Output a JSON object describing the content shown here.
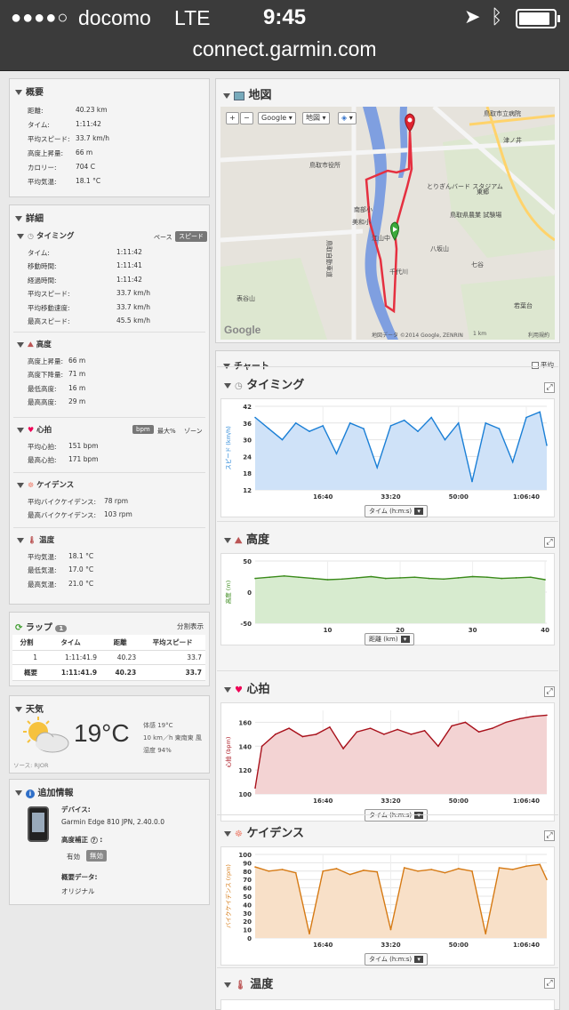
{
  "statusbar": {
    "signal": "●●●●○",
    "carrier": "docomo",
    "network": "LTE",
    "time": "9:45"
  },
  "browser": {
    "url": "connect.garmin.com"
  },
  "summary": {
    "title": "概要",
    "rows": [
      {
        "label": "距離:",
        "value": "40.23 km"
      },
      {
        "label": "タイム:",
        "value": "1:11:42"
      },
      {
        "label": "平均スピード:",
        "value": "33.7 km/h"
      },
      {
        "label": "高度上昇量:",
        "value": "66 m"
      },
      {
        "label": "カロリー:",
        "value": "704 C"
      },
      {
        "label": "平均気温:",
        "value": "18.1 °C"
      }
    ]
  },
  "details": {
    "title": "詳細",
    "timing": {
      "title": "タイミング",
      "toggle_pace": "ペース",
      "toggle_speed": "スピード",
      "rows": [
        {
          "label": "タイム:",
          "value": "1:11:42"
        },
        {
          "label": "移動時間:",
          "value": "1:11:41"
        },
        {
          "label": "経過時間:",
          "value": "1:11:42"
        },
        {
          "label": "平均スピード:",
          "value": "33.7 km/h"
        },
        {
          "label": "平均移動速度:",
          "value": "33.7 km/h"
        },
        {
          "label": "最高スピード:",
          "value": "45.5 km/h"
        }
      ]
    },
    "elevation": {
      "title": "高度",
      "rows": [
        {
          "label": "高度上昇量:",
          "value": "66 m"
        },
        {
          "label": "高度下降量:",
          "value": "71 m"
        },
        {
          "label": "最低高度:",
          "value": "16 m"
        },
        {
          "label": "最高高度:",
          "value": "29 m"
        }
      ]
    },
    "heartrate": {
      "title": "心拍",
      "chip_bpm": "bpm",
      "chip_max": "最大%",
      "chip_zone": "ゾーン",
      "rows": [
        {
          "label": "平均心拍:",
          "value": "151 bpm"
        },
        {
          "label": "最高心拍:",
          "value": "171 bpm"
        }
      ]
    },
    "cadence": {
      "title": "ケイデンス",
      "rows": [
        {
          "label": "平均バイクケイデンス:",
          "value": "78 rpm"
        },
        {
          "label": "最高バイクケイデンス:",
          "value": "103 rpm"
        }
      ]
    },
    "temperature": {
      "title": "温度",
      "rows": [
        {
          "label": "平均気温:",
          "value": "18.1 °C"
        },
        {
          "label": "最低気温:",
          "value": "17.0 °C"
        },
        {
          "label": "最高気温:",
          "value": "21.0 °C"
        }
      ]
    }
  },
  "laps": {
    "title": "ラップ",
    "count": "1",
    "action": "分割表示",
    "headers": [
      "分割",
      "タイム",
      "距離",
      "平均スピード"
    ],
    "rows": [
      [
        "1",
        "1:11:41.9",
        "40.23",
        "33.7"
      ],
      [
        "概要",
        "1:11:41.9",
        "40.23",
        "33.7"
      ]
    ]
  },
  "weather": {
    "title": "天気",
    "temp": "19°C",
    "line1": "体感 19°C",
    "line2": "10 km／h 東南東 風",
    "line3": "湿度 94%",
    "source": "ソース: RJOR"
  },
  "info": {
    "title": "追加情報",
    "device_label": "デバイス:",
    "device": "Garmin Edge 810 JPN, 2.40.0.0",
    "elev_label": "高度補正",
    "elev_on": "有効",
    "elev_off": "無効",
    "data_label": "概要データ:",
    "data_value": "オリジナル"
  },
  "map": {
    "title": "地図",
    "zoom_in": "+",
    "zoom_out": "−",
    "btn_google": "Google",
    "btn_map": "地図",
    "attribution": "地図データ ©2014 Google, ZENRIN",
    "scale": "1 km",
    "terms": "利用規約",
    "logo": "Google",
    "places": [
      "鳥取市役所",
      "鳥取市立病院",
      "とりぎんバード スタジアム",
      "東郷",
      "鳥取県農業 試験場",
      "八坂山",
      "江山中",
      "美和小",
      "千代川",
      "七谷",
      "表谷山",
      "津ノ井",
      "鳥取自動車道",
      "若葉台",
      "南部小"
    ]
  },
  "charts": {
    "title": "チャート",
    "avg_label": "平均",
    "speed": {
      "title": "タイミング",
      "selector": "タイム (h:m:s)"
    },
    "elevation": {
      "title": "高度",
      "selector": "距離 (km)"
    },
    "hr": {
      "title": "心拍",
      "selector": "タイム (h:m:s)"
    },
    "cadence": {
      "title": "ケイデンス",
      "selector": "タイム (h:m:s)"
    },
    "temp": {
      "title": "温度"
    }
  },
  "chart_data": [
    {
      "type": "area",
      "title": "タイミング",
      "ylabel": "スピード (km/h)",
      "xlabel": "",
      "ylim": [
        12,
        42
      ],
      "yticks": [
        12,
        18,
        24,
        30,
        36,
        42
      ],
      "xticks": [
        "16:40",
        "33:20",
        "50:00",
        "1:06:40"
      ],
      "xrange_seconds": [
        0,
        4302
      ],
      "x": [
        0,
        200,
        400,
        600,
        800,
        1000,
        1200,
        1400,
        1600,
        1800,
        2000,
        2200,
        2400,
        2600,
        2800,
        3000,
        3200,
        3400,
        3600,
        3800,
        4000,
        4200,
        4302
      ],
      "y": [
        38,
        34,
        30,
        36,
        33,
        35,
        25,
        36,
        34,
        20,
        35,
        37,
        33,
        38,
        30,
        36,
        15,
        36,
        34,
        22,
        38,
        40,
        28
      ],
      "color": "#1a7fd6"
    },
    {
      "type": "area",
      "title": "高度",
      "ylabel": "高度 (m)",
      "xlabel": "",
      "ylim": [
        -50,
        50
      ],
      "yticks": [
        -50,
        0,
        50
      ],
      "xticks": [
        10,
        20,
        30,
        40
      ],
      "xrange": [
        0,
        40.23
      ],
      "x": [
        0,
        2,
        4,
        6,
        8,
        10,
        12,
        14,
        16,
        18,
        20,
        22,
        24,
        26,
        28,
        30,
        32,
        34,
        36,
        38,
        40
      ],
      "y": [
        22,
        24,
        26,
        24,
        22,
        20,
        21,
        23,
        25,
        22,
        23,
        24,
        22,
        21,
        23,
        25,
        24,
        22,
        23,
        24,
        20
      ],
      "color": "#3a8a1a"
    },
    {
      "type": "area",
      "title": "心拍",
      "ylabel": "心拍 (bpm)",
      "xlabel": "",
      "ylim": [
        100,
        170
      ],
      "yticks": [
        100,
        120,
        140,
        160
      ],
      "xticks": [
        "16:40",
        "33:20",
        "50:00",
        "1:06:40"
      ],
      "xrange_seconds": [
        0,
        4302
      ],
      "x": [
        0,
        100,
        300,
        500,
        700,
        900,
        1100,
        1300,
        1500,
        1700,
        1900,
        2100,
        2300,
        2500,
        2700,
        2900,
        3100,
        3300,
        3500,
        3700,
        3900,
        4100,
        4302
      ],
      "y": [
        105,
        140,
        150,
        155,
        148,
        150,
        156,
        138,
        152,
        155,
        150,
        154,
        150,
        153,
        140,
        157,
        160,
        152,
        155,
        160,
        163,
        165,
        166
      ],
      "color": "#a8101a"
    },
    {
      "type": "area",
      "title": "ケイデンス",
      "ylabel": "バイクケイデンス (rpm)",
      "xlabel": "",
      "ylim": [
        0,
        100
      ],
      "yticks": [
        0,
        10,
        20,
        30,
        40,
        50,
        60,
        70,
        80,
        90,
        100
      ],
      "xticks": [
        "16:40",
        "33:20",
        "50:00",
        "1:06:40"
      ],
      "xrange_seconds": [
        0,
        4302
      ],
      "x": [
        0,
        200,
        400,
        600,
        800,
        1000,
        1200,
        1400,
        1600,
        1800,
        2000,
        2200,
        2400,
        2600,
        2800,
        3000,
        3200,
        3400,
        3600,
        3800,
        4000,
        4200,
        4302
      ],
      "y": [
        85,
        80,
        82,
        78,
        5,
        80,
        83,
        76,
        81,
        79,
        10,
        84,
        80,
        82,
        78,
        83,
        80,
        5,
        84,
        82,
        86,
        88,
        70
      ],
      "color": "#d67a14"
    }
  ]
}
